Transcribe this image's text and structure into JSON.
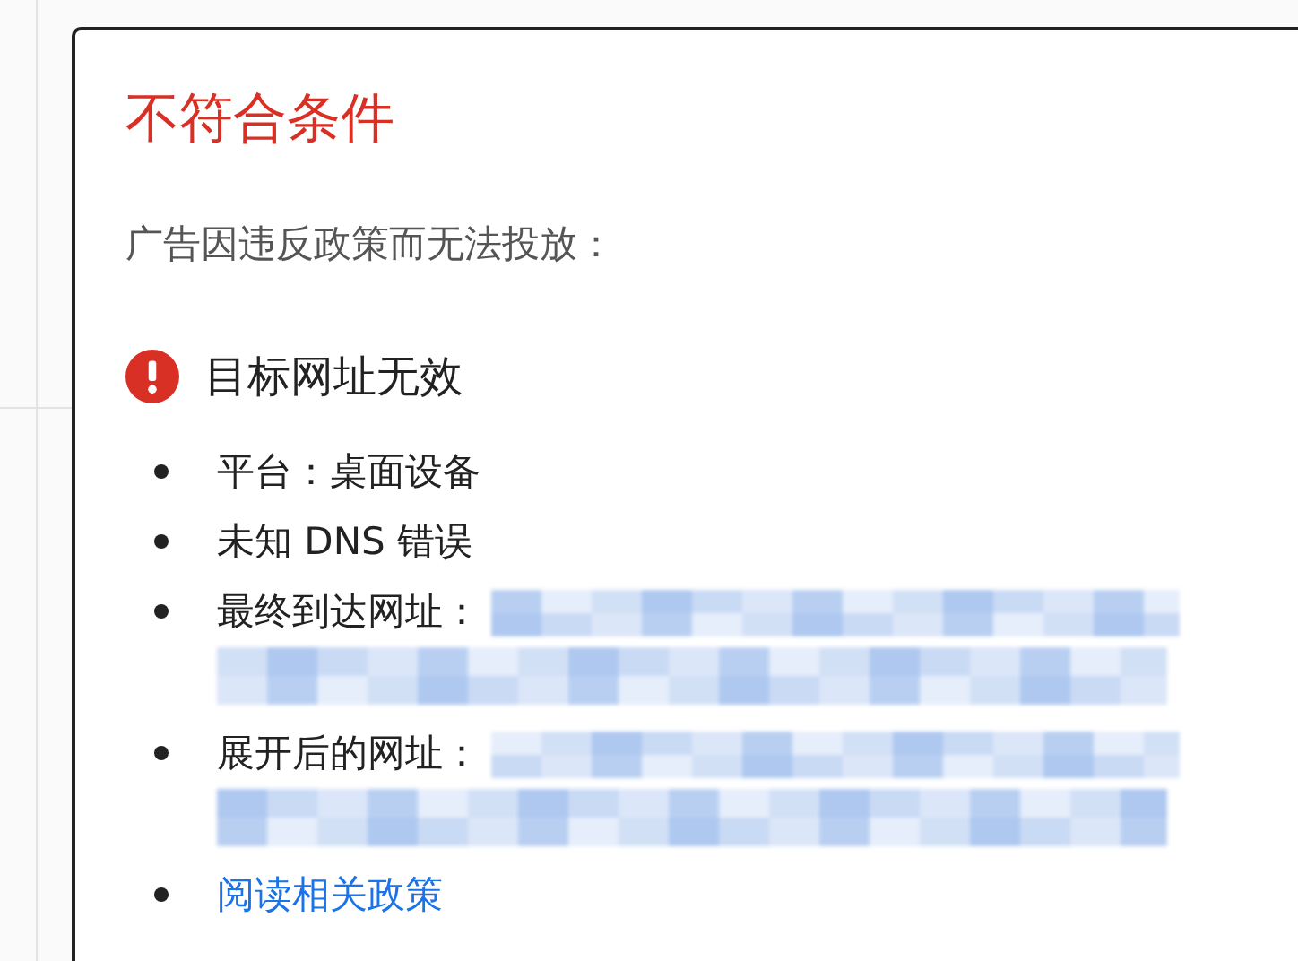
{
  "card": {
    "title": "不符合条件",
    "message": "广告因违反政策而无法投放：",
    "issue": {
      "error": true,
      "heading": "目标网址无效"
    },
    "details": [
      {
        "kind": "text",
        "label": "平台：桌面设备"
      },
      {
        "kind": "text",
        "label": "未知 DNS 错误"
      },
      {
        "kind": "url",
        "label": "最终到达网址："
      },
      {
        "kind": "url",
        "label": "展开后的网址："
      },
      {
        "kind": "link",
        "label": "阅读相关政策"
      }
    ]
  }
}
